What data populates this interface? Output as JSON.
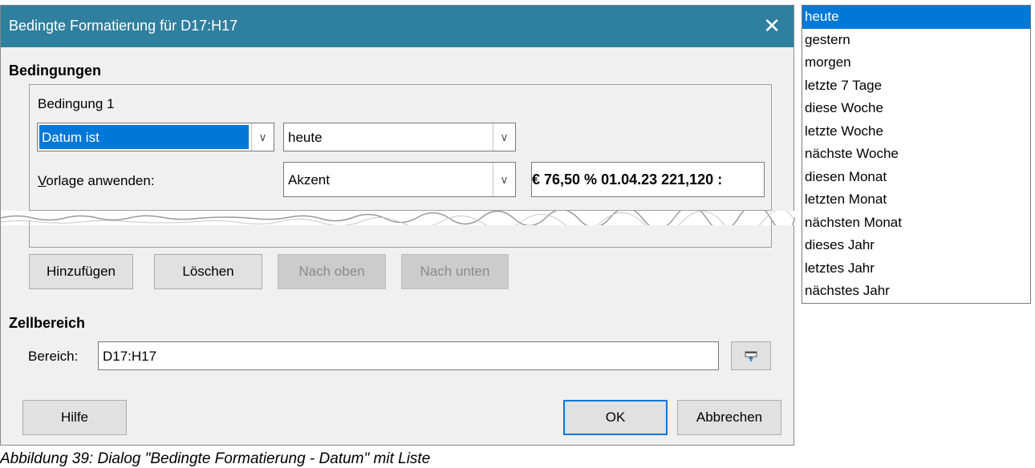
{
  "dialog": {
    "title": "Bedingte Formatierung für D17:H17",
    "close_glyph": "✕",
    "conditions_label": "Bedingungen",
    "condition_title": "Bedingung 1",
    "condition_type": "Datum ist",
    "date_value": "heute",
    "apply_style_label": "Vorlage anwenden:",
    "style_value": "Akzent",
    "preview_text": "€ 76,50 % 01.04.23 221,120 :",
    "buttons": {
      "add": "Hinzufügen",
      "delete": "Löschen",
      "up": "Nach oben",
      "down": "Nach unten"
    },
    "cell_range_label": "Zellbereich",
    "range_label": "Bereich:",
    "range_value": "D17:H17",
    "help": "Hilfe",
    "ok": "OK",
    "cancel": "Abbrechen"
  },
  "dropdown_list": {
    "items": [
      "heute",
      "gestern",
      "morgen",
      "letzte 7 Tage",
      "diese Woche",
      "letzte Woche",
      "nächste Woche",
      "diesen Monat",
      "letzten Monat",
      "nächsten Monat",
      "dieses Jahr",
      "letztes Jahr",
      "nächstes Jahr"
    ],
    "selected": "heute"
  },
  "caption": "Abbildung 39: Dialog \"Bedingte Formatierung - Datum\" mit Liste",
  "colors": {
    "titlebar": "#2f7f9e",
    "selection": "#0078d7"
  }
}
